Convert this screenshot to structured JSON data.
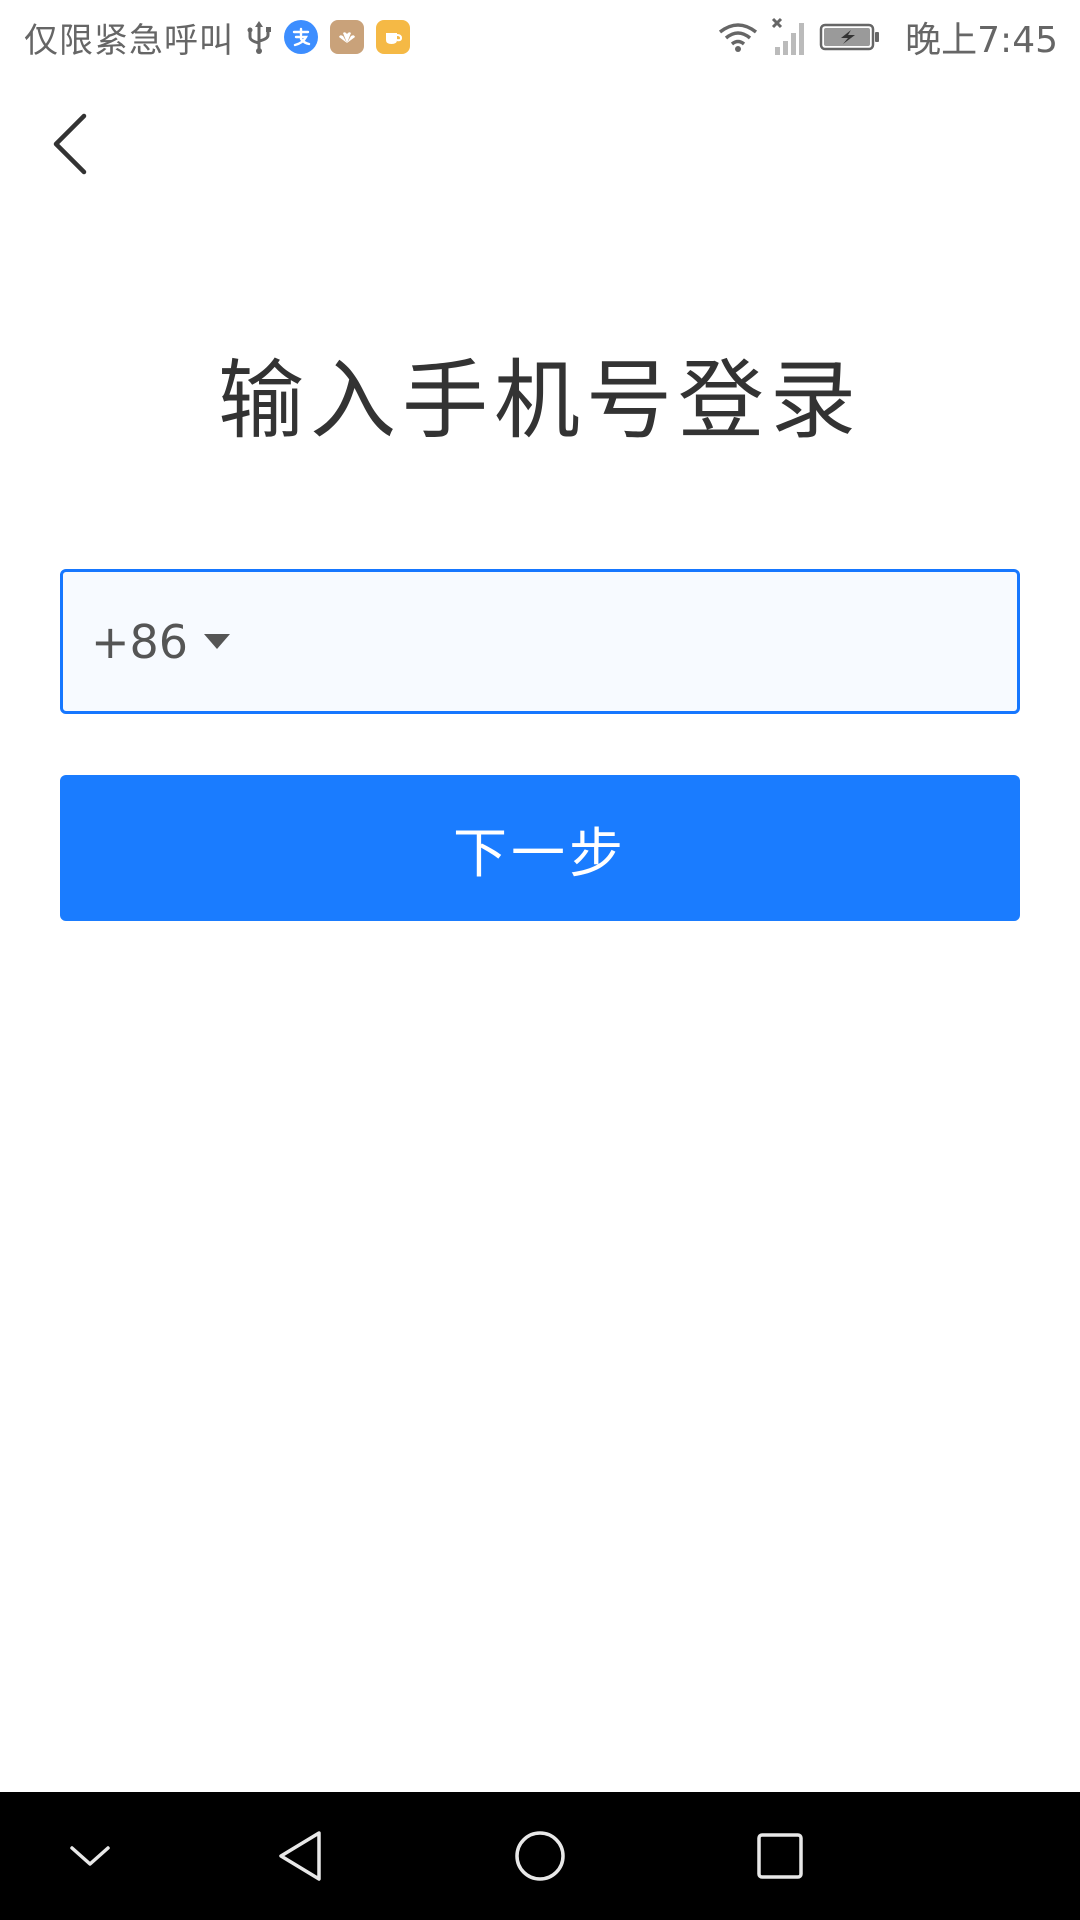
{
  "status_bar": {
    "carrier": "仅限紧急呼叫",
    "time": "晚上7:45",
    "icons": [
      "usb-icon",
      "alipay-app-icon",
      "huawei-app-icon",
      "cup-app-icon",
      "wifi-icon",
      "no-signal-icon",
      "battery-charging-icon"
    ],
    "colors": {
      "alipay": "#3d8eff",
      "huawei": "#c9a27a",
      "cup": "#f5b945"
    }
  },
  "header": {
    "back_icon": "chevron-left-icon"
  },
  "main": {
    "title": "输入手机号登录",
    "phone": {
      "country_code": "+86",
      "value": "",
      "placeholder": ""
    },
    "next_label": "下一步"
  },
  "nav_bar": {
    "buttons": [
      "chevron-down-icon",
      "back-triangle-icon",
      "home-circle-icon",
      "recents-square-icon"
    ]
  },
  "colors": {
    "accent": "#1a7cff",
    "input_border": "#1677ff",
    "input_bg": "#f7faff",
    "title": "#333333"
  }
}
